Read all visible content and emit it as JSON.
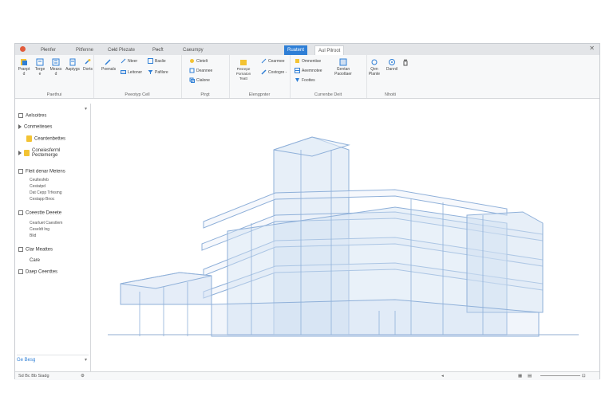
{
  "tabs": [
    "Pl̶enfer",
    "Pitfenne",
    "Ce̶ld Plezate",
    "Pe̶cft",
    "Caeumpy",
    "Ruatent",
    "Aul Pilroot"
  ],
  "active_tab_index": 5,
  "ribbon": {
    "groups": [
      {
        "label": "Paethui"
      },
      {
        "label": "Peeotyp Cell"
      },
      {
        "label": "Pirgt"
      },
      {
        "label": "Elengpnter"
      },
      {
        "label": "Currenbe Deit"
      },
      {
        "label": "Nhoiti"
      }
    ],
    "tools": {
      "t1": "Pranpt\nd",
      "t2": "Terge\ne",
      "t3": "Meaxs\nd",
      "t4": "Aapiygs",
      "t5": "Dorts",
      "t6": "Poenals",
      "r1": "Nteer",
      "r2": "Baslie",
      "r3": "Leitoner",
      "r4": "Pafilsre",
      "r5": "Cletelt",
      "r6": "Deannee",
      "r7": "Cialone",
      "r8": "Cearmee",
      "r9": "Costogre -",
      "t7": "Pesrepe\nPornaton\nTeatt",
      "r10": "Omnentise",
      "r11": "Aeemnotee",
      "r12": "Foottes",
      "t8": "Gentan\nPaoottaer",
      "t9": "Qen\nPlante",
      "t10": "Dannil"
    }
  },
  "tree": {
    "i1": "Aelsoitres",
    "i2": "Conmeiteaes",
    "i3": "Ceantenbettes",
    "i4": "Coneiesferml\nPectemerge",
    "i5": "Fleit denar Metens",
    "s1": "Ceultesfeb",
    "s2": "Cestatpd",
    "s3": "Dat Cepp Trfesmg",
    "s4": "Cestapp Bnoc",
    "i6": "Coeestte Deeete",
    "s5": "Cearluet Caestlem",
    "s6": "Ceseldt lng",
    "s7": "Blid",
    "i7": "Clar Meattes",
    "i8": "Care",
    "i9": "Daep Ceenttes",
    "bottom": "Ge Besg"
  },
  "status": {
    "left": "Sd Bc Bb Siadg"
  },
  "colors": {
    "accent": "#2f7fd6",
    "building_stroke": "#8fb0d9",
    "building_fill": "#cfdff2"
  }
}
